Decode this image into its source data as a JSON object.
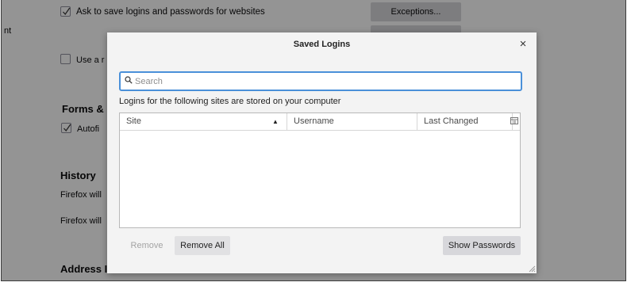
{
  "background": {
    "ask_save_label": "Ask to save logins and passwords for websites",
    "exceptions_label": "Exceptions...",
    "cut_left_text": "nt",
    "use_a_label": "Use a r",
    "forms_heading": "Forms &",
    "autofill_label": "Autofi",
    "history_heading": "History",
    "firefox_will_1": "Firefox will",
    "firefox_will_2": "Firefox will",
    "address_heading": "Address I"
  },
  "dialog": {
    "title": "Saved Logins",
    "close_symbol": "×",
    "search_placeholder": "Search",
    "search_value": "",
    "caption": "Logins for the following sites are stored on your computer",
    "table": {
      "columns": [
        "Site",
        "Username",
        "Last Changed"
      ],
      "sorted_column": "Site",
      "sort_direction": "ascending",
      "rows": []
    },
    "buttons": {
      "remove": "Remove",
      "remove_all": "Remove All",
      "show_passwords": "Show Passwords"
    }
  },
  "colors": {
    "focus_ring": "#4a90d9",
    "overlay": "rgba(0,0,0,0.42)",
    "dialog_bg": "#f3f3f3"
  }
}
